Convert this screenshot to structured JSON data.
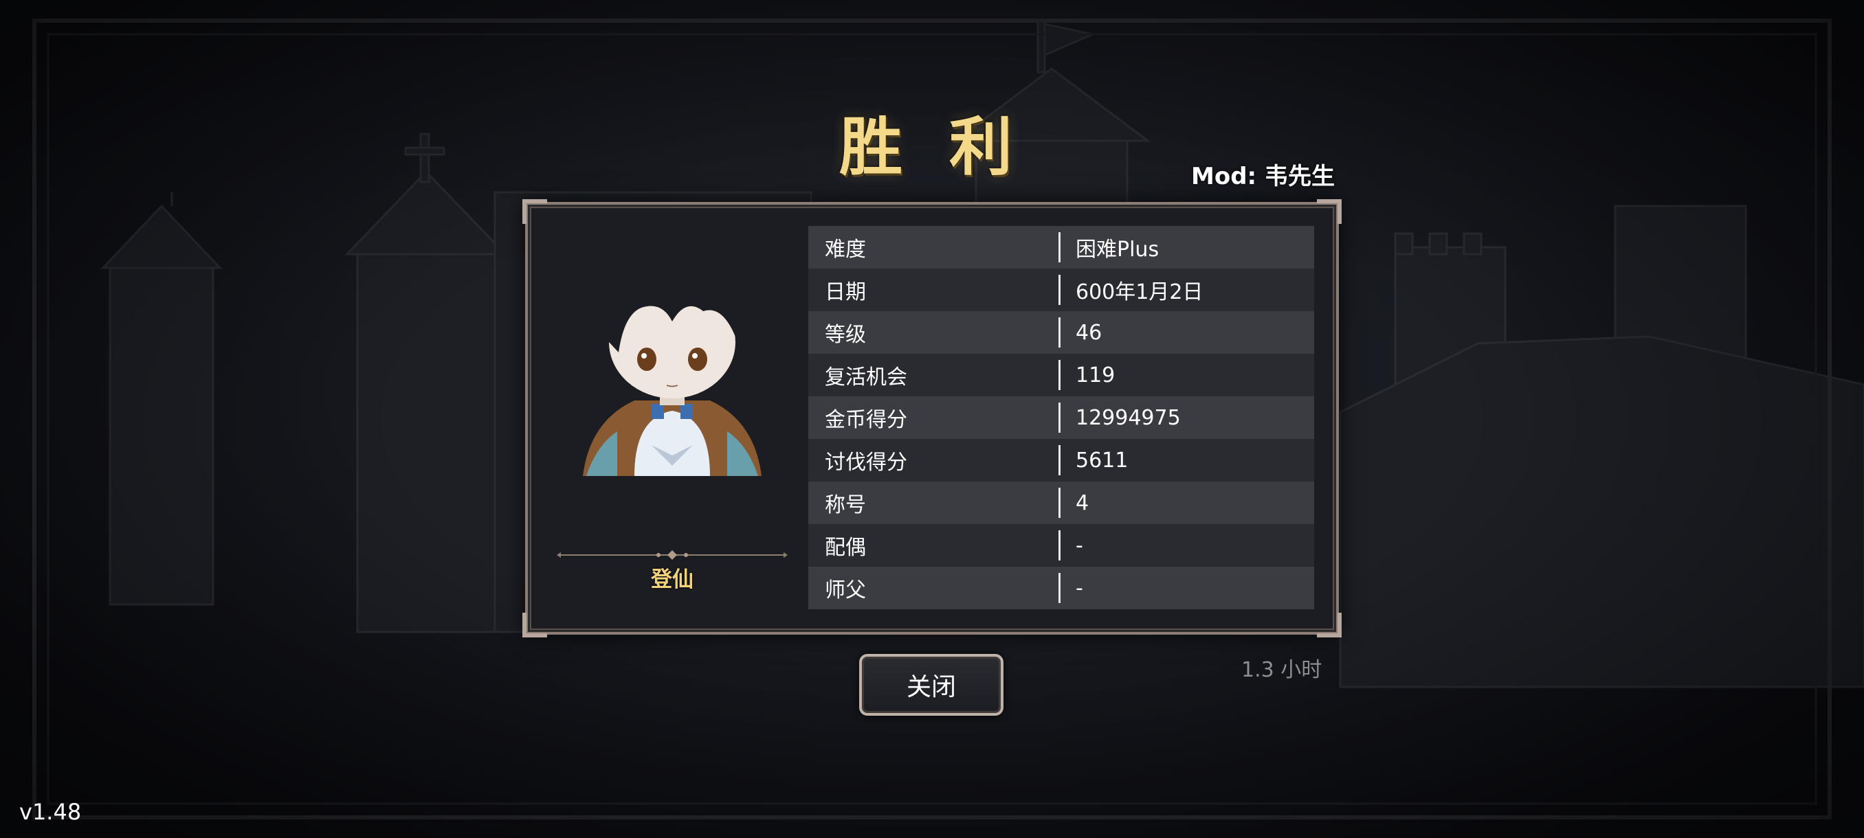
{
  "title": "胜 利",
  "mod_label": "Mod: 韦先生",
  "character": {
    "name": "登仙"
  },
  "stats": [
    {
      "label": "难度",
      "value": "困难Plus"
    },
    {
      "label": "日期",
      "value": "600年1月2日"
    },
    {
      "label": "等级",
      "value": "46"
    },
    {
      "label": "复活机会",
      "value": "119"
    },
    {
      "label": "金币得分",
      "value": "12994975"
    },
    {
      "label": "讨伐得分",
      "value": "5611"
    },
    {
      "label": "称号",
      "value": "4"
    },
    {
      "label": "配偶",
      "value": "-"
    },
    {
      "label": "师父",
      "value": "-"
    }
  ],
  "play_time": "1.3 小时",
  "close_button": "关闭",
  "version": "v1.48",
  "colors": {
    "title_gold": "#f4d98a",
    "name_gold": "#f2d37c",
    "panel_bg": "#1c1d22",
    "row_light": "#3b3c42",
    "row_dark": "#2a2b30",
    "frame": "#8c7c76"
  }
}
